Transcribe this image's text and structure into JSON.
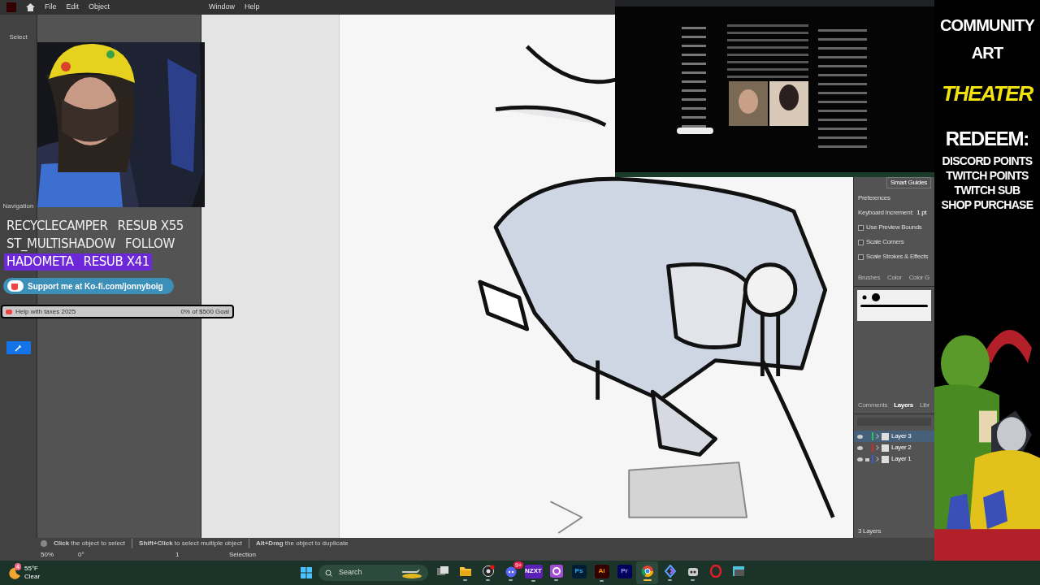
{
  "menu": [
    "File",
    "Edit",
    "Object",
    "Window",
    "Help"
  ],
  "tool_labels": [
    "Select",
    "Navigation"
  ],
  "alerts": [
    {
      "name": "RECYCLECAMPER",
      "event": "RESUB X55",
      "highlighted": false
    },
    {
      "name": "ST_MULTISHADOW",
      "event": "FOLLOW",
      "highlighted": false
    },
    {
      "name": "HADOMETA",
      "event": "RESUB X41",
      "highlighted": true
    }
  ],
  "kofi": "Support me at Ko-fi.com/jonnyboig",
  "goal": {
    "title": "Help with taxes 2025",
    "progress": "0% of $500 Goal",
    "level": 0
  },
  "properties": {
    "smart_guides": "Smart Guides",
    "section": "Preferences",
    "increment_label": "Keyboard Increment:",
    "increment": "1 pt",
    "options": [
      {
        "label": "Use Preview Bounds",
        "checked": false
      },
      {
        "label": "Scale Corners",
        "checked": false
      },
      {
        "label": "Scale Strokes & Effects",
        "checked": false
      }
    ]
  },
  "brush_tabs": [
    {
      "label": "Brushes",
      "selected": false
    },
    {
      "label": "Color",
      "selected": false
    },
    {
      "label": "Color G",
      "selected": false
    }
  ],
  "layer_tabs": [
    {
      "label": "Comments",
      "selected": false
    },
    {
      "label": "Layers",
      "selected": true
    },
    {
      "label": "Libr",
      "selected": false
    }
  ],
  "layers": [
    {
      "name": "Layer 3",
      "color": "#22c55e",
      "selected": true,
      "locked": false
    },
    {
      "name": "Layer 2",
      "color": "#dc2626",
      "selected": false,
      "locked": false
    },
    {
      "name": "Layer 1",
      "color": "#3b5bdb",
      "selected": false,
      "locked": true
    }
  ],
  "layer_count": "3 Layers",
  "hints": [
    "**Click** the object to select",
    "**Shift+Click** to select multiple object",
    "**Alt+Drag** the object to duplicate"
  ],
  "status": {
    "zoom": "50%",
    "rotation": "0°",
    "artboard": "1",
    "tool": "Selection"
  },
  "overlay": {
    "title_lines": [
      "COMMUNITY",
      "ART"
    ],
    "highlight": "THEATER",
    "redeem": "REDEEM:",
    "options": [
      "DISCORD POINTS",
      "TWITCH POINTS",
      "TWITCH SUB",
      "SHOP PURCHASE"
    ]
  },
  "weather": {
    "badge": "4",
    "temp": "55°F",
    "condition": "Clear"
  },
  "search": {
    "placeholder": "Search"
  },
  "apps": [
    {
      "kind": "taskview",
      "running": false,
      "active": false
    },
    {
      "kind": "folder",
      "running": true,
      "active": false
    },
    {
      "kind": "record",
      "running": true,
      "active": false
    },
    {
      "kind": "chat",
      "running": true,
      "active": false,
      "badge": "9+"
    },
    {
      "kind": "nzxt",
      "label": "NZXT",
      "running": true,
      "active": false
    },
    {
      "kind": "ring",
      "running": true,
      "active": false
    },
    {
      "kind": "photoshop",
      "label": "Ps",
      "running": false,
      "active": false
    },
    {
      "kind": "illustrator",
      "label": "Ai",
      "running": true,
      "active": false
    },
    {
      "kind": "premiere",
      "label": "Pr",
      "running": false,
      "active": false
    },
    {
      "kind": "browser",
      "running": true,
      "active": true
    },
    {
      "kind": "diamond",
      "running": true,
      "active": false
    },
    {
      "kind": "robot",
      "running": true,
      "active": false
    },
    {
      "kind": "opera",
      "running": false,
      "active": false
    },
    {
      "kind": "window",
      "running": false,
      "active": false
    }
  ]
}
